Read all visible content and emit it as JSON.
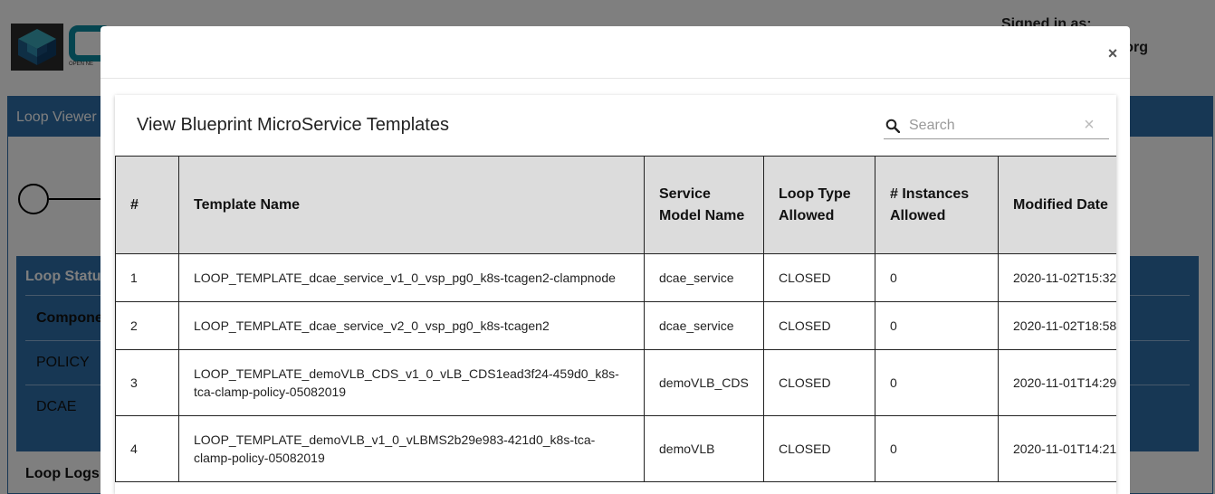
{
  "background": {
    "logo_text": "OPEN NE",
    "signed_in_label": "Signed in as:",
    "signed_in_user": "o.org",
    "loop_viewer_title": "Loop Viewer",
    "loop_status_title": "Loop Status",
    "status_component_header": "Compone",
    "status_items": [
      "POLICY",
      "DCAE"
    ],
    "loop_logs_title": "Loop Logs"
  },
  "modal": {
    "close_label": "×",
    "title": "View Blueprint MicroService Templates",
    "search": {
      "placeholder": "Search",
      "value": "",
      "clear_label": "×"
    },
    "table": {
      "columns": [
        "#",
        "Template Name",
        "Service Model Name",
        "Loop Type Allowed",
        "# Instances Allowed",
        "Modified Date"
      ],
      "rows": [
        {
          "num": "1",
          "name": "LOOP_TEMPLATE_dcae_service_v1_0_vsp_pg0_k8s-tcagen2-clampnode",
          "service": "dcae_service",
          "loop_type": "CLOSED",
          "instances": "0",
          "date": "2020-11-02T15:32"
        },
        {
          "num": "2",
          "name": "LOOP_TEMPLATE_dcae_service_v2_0_vsp_pg0_k8s-tcagen2",
          "service": "dcae_service",
          "loop_type": "CLOSED",
          "instances": "0",
          "date": "2020-11-02T18:58"
        },
        {
          "num": "3",
          "name": "LOOP_TEMPLATE_demoVLB_CDS_v1_0_vLB_CDS1ead3f24-459d0_k8s-tca-clamp-policy-05082019",
          "service": "demoVLB_CDS",
          "loop_type": "CLOSED",
          "instances": "0",
          "date": "2020-11-01T14:29"
        },
        {
          "num": "4",
          "name": "LOOP_TEMPLATE_demoVLB_v1_0_vLBMS2b29e983-421d0_k8s-tca-clamp-policy-05082019",
          "service": "demoVLB",
          "loop_type": "CLOSED",
          "instances": "0",
          "date": "2020-11-01T14:21"
        }
      ]
    }
  },
  "colors": {
    "primary_panel": "#2f6ea8",
    "header_gray": "#dcdcdc",
    "backdrop": "rgba(0,0,0,0.5)"
  },
  "icons": {
    "search": "search-icon",
    "close": "close-icon",
    "clear": "clear-icon"
  }
}
